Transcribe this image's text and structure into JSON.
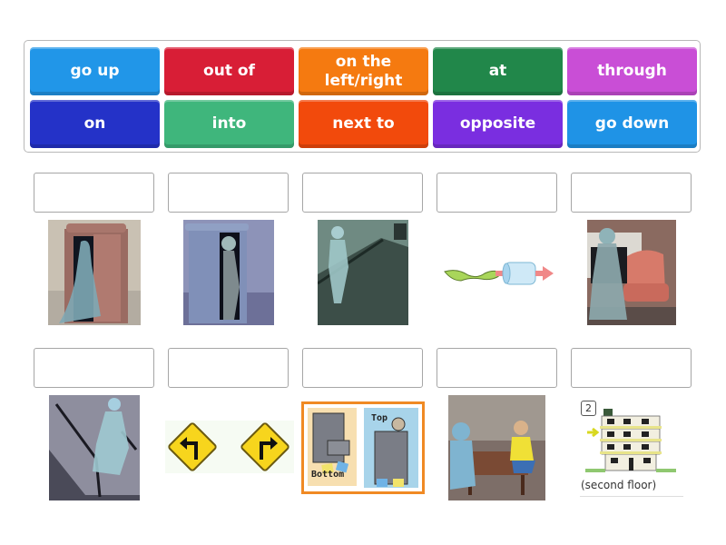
{
  "tiles": [
    {
      "label": "go up",
      "color": "#2196e8"
    },
    {
      "label": "out of",
      "color": "#d81e36"
    },
    {
      "label": "on the\nleft/right",
      "color": "#f57a10"
    },
    {
      "label": "at",
      "color": "#21874a"
    },
    {
      "label": "through",
      "color": "#c94ed6"
    },
    {
      "label": "on",
      "color": "#2432c8"
    },
    {
      "label": "into",
      "color": "#3fb67c"
    },
    {
      "label": "next to",
      "color": "#f24a0c"
    },
    {
      "label": "opposite",
      "color": "#7a2ee0"
    },
    {
      "label": "go down",
      "color": "#1f93e6"
    }
  ],
  "slots": [
    {
      "image": "ghost-woman-entering-wardrobe"
    },
    {
      "image": "ghost-coming-out-of-wardrobe"
    },
    {
      "image": "ghost-going-up-stairs"
    },
    {
      "image": "worm-through-tube"
    },
    {
      "image": "ghost-next-to-armchair"
    },
    {
      "image": "ghost-going-down-stairs"
    },
    {
      "image": "left-right-turn-signs"
    },
    {
      "image": "filing-cabinets-top-bottom"
    },
    {
      "image": "ghost-opposite-woman-at-table"
    },
    {
      "image": "building-second-floor"
    }
  ],
  "image_text": {
    "cabinet_bottom": "Bottom",
    "cabinet_top": "Top",
    "floor_number": "2",
    "floor_caption": "(second floor)"
  }
}
